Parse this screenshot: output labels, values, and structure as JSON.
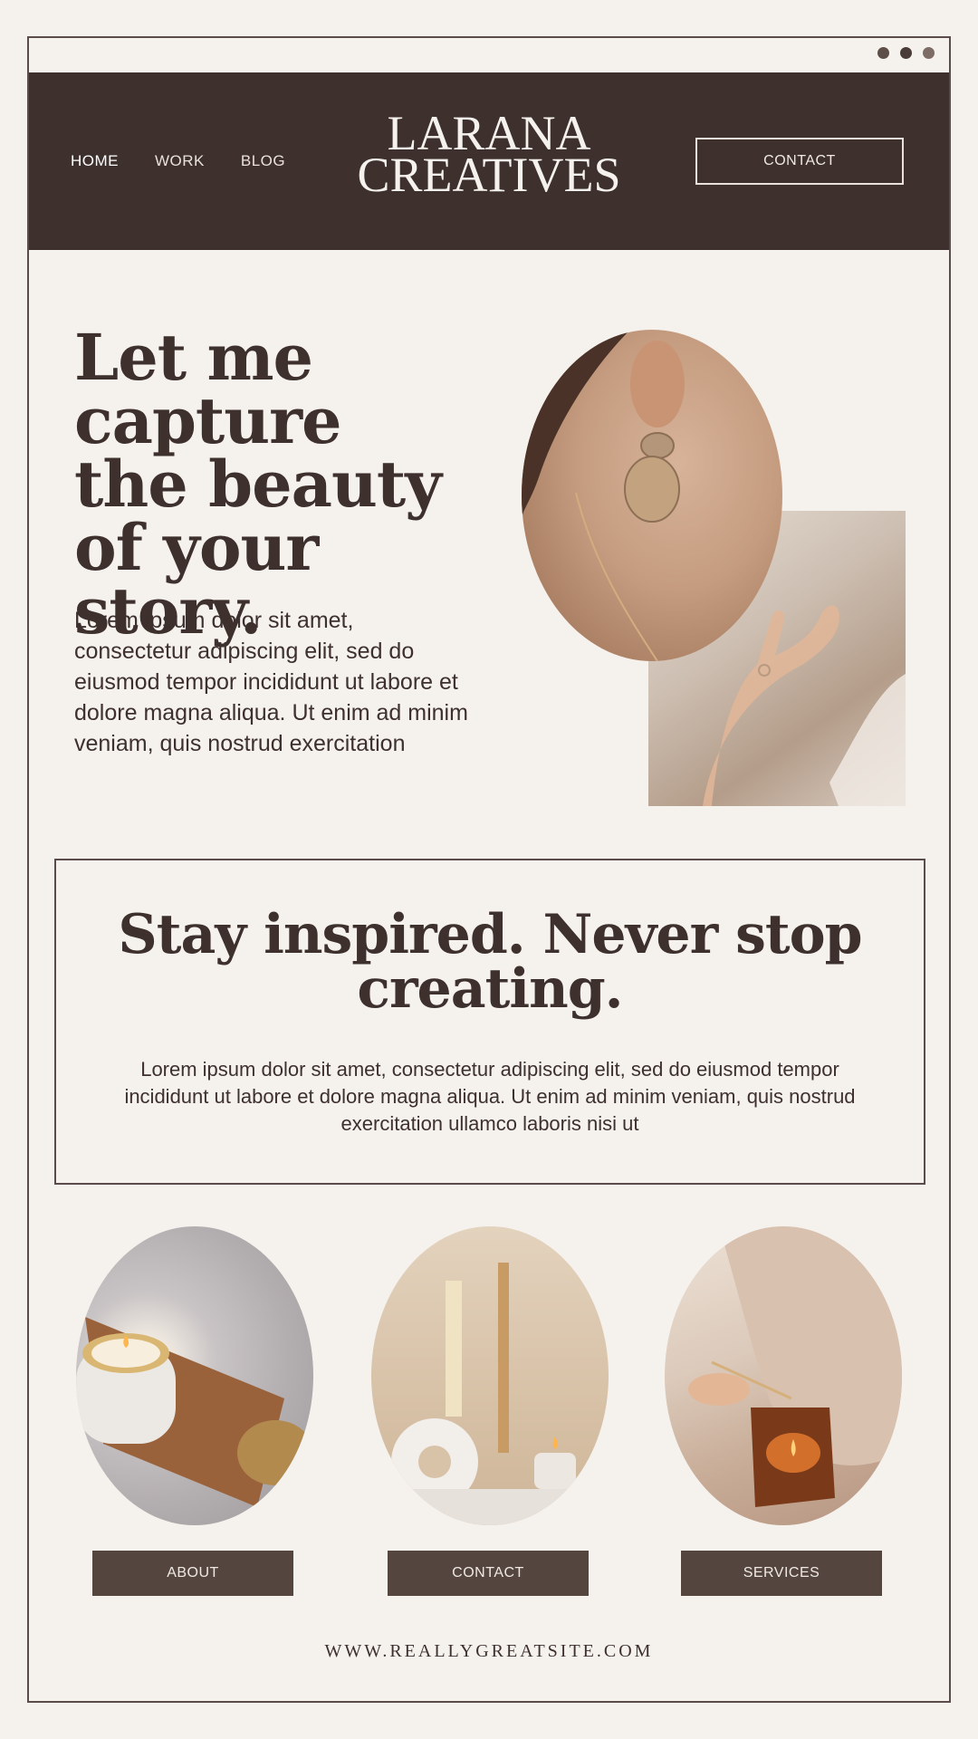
{
  "window": {
    "dots": [
      {
        "name": "dot-1",
        "color": "#5d4e4a"
      },
      {
        "name": "dot-2",
        "color": "#4a3c38"
      },
      {
        "name": "dot-3",
        "color": "#7d6b66"
      }
    ]
  },
  "header": {
    "nav": [
      {
        "label": "HOME",
        "active": true
      },
      {
        "label": "WORK",
        "active": false
      },
      {
        "label": "BLOG",
        "active": false
      }
    ],
    "logo_line1": "LARANA",
    "logo_line2": "CREATIVES",
    "contact_label": "CONTACT"
  },
  "hero": {
    "title": "Let me capture the beauty of your story.",
    "text": "Lorem ipsum dolor sit amet, consectetur adipiscing elit, sed do eiusmod tempor incididunt ut labore et dolore magna aliqua. Ut enim ad minim veniam, quis nostrud exercitation"
  },
  "quote": {
    "title": "Stay inspired. Never stop creating.",
    "text": "Lorem ipsum dolor sit amet, consectetur adipiscing elit, sed do eiusmod tempor incididunt ut labore et dolore magna aliqua. Ut enim ad minim veniam, quis nostrud exercitation ullamco laboris nisi ut"
  },
  "buttons": {
    "about": "ABOUT",
    "contact": "CONTACT",
    "services": "SERVICES"
  },
  "footer": {
    "url": "WWW.REALLYGREATSITE.COM"
  },
  "colors": {
    "background": "#f5f2ee",
    "header": "#3d302d",
    "button": "#54453f",
    "text": "#3d302d"
  }
}
